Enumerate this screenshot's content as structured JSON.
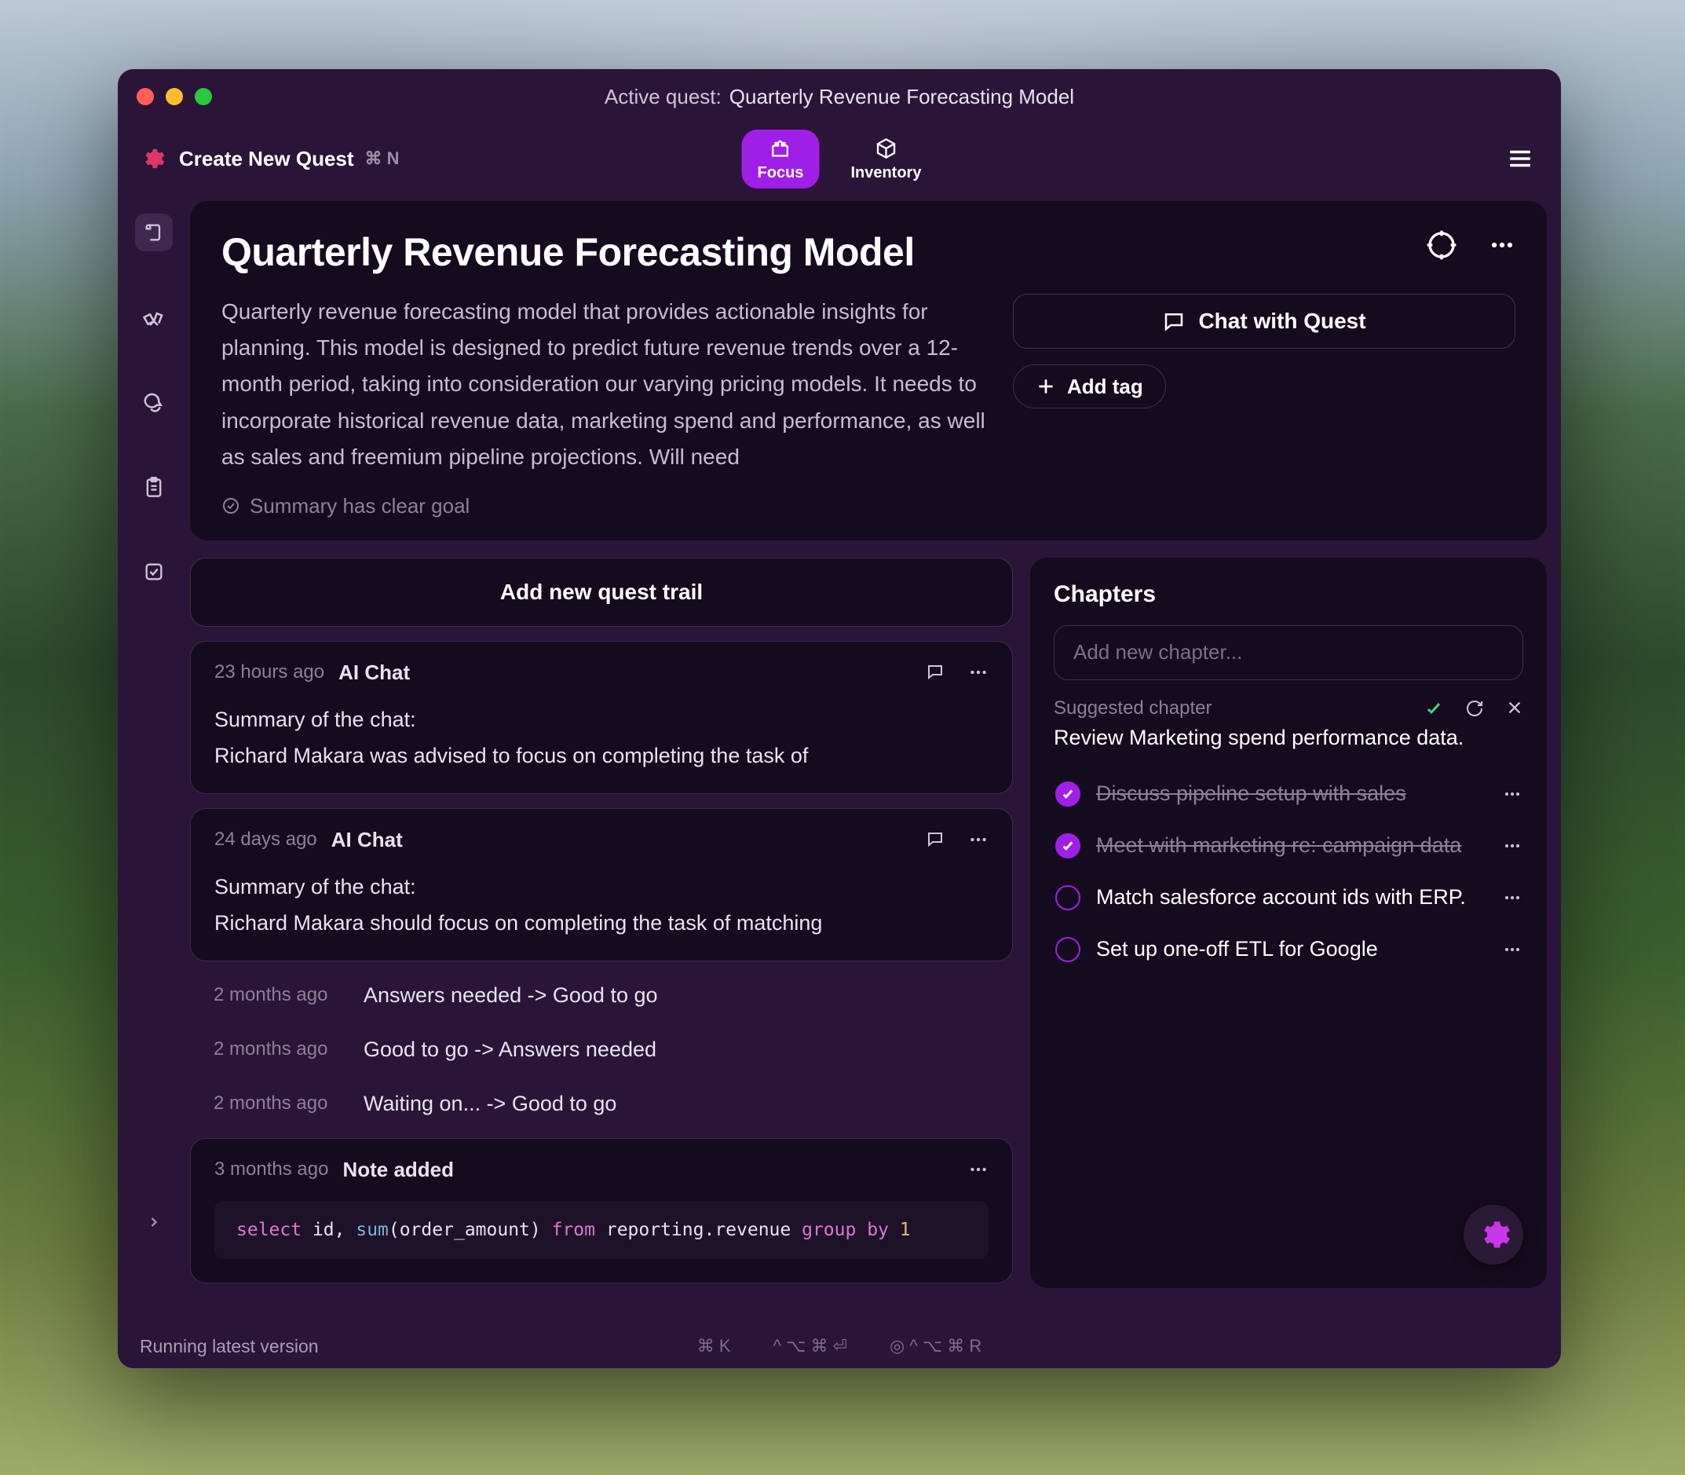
{
  "titlebar": {
    "label": "Active quest:",
    "value": "Quarterly Revenue Forecasting Model"
  },
  "toolbar": {
    "create_label": "Create New Quest",
    "create_shortcut": "⌘ N",
    "tabs": {
      "focus": "Focus",
      "inventory": "Inventory"
    }
  },
  "quest": {
    "title": "Quarterly Revenue Forecasting Model",
    "description": "Quarterly revenue forecasting model that provides actionable insights for planning. This model is designed to predict future revenue trends over a 12-month period, taking into consideration our varying pricing models. It needs to incorporate historical revenue data, marketing spend and performance, as well as sales and freemium pipeline projections. Will need",
    "chat_label": "Chat with Quest",
    "add_tag_label": "Add tag",
    "summary_status": "Summary has clear goal"
  },
  "trail": {
    "add_label": "Add new quest trail",
    "items": [
      {
        "time": "23 hours ago",
        "type": "AI Chat",
        "body_line1": "Summary of the chat:",
        "body_line2": "Richard Makara was advised to focus on completing the task of"
      },
      {
        "time": "24 days ago",
        "type": "AI Chat",
        "body_line1": "Summary of the chat:",
        "body_line2": "Richard Makara should focus on completing the task of matching"
      }
    ],
    "status_changes": [
      {
        "time": "2 months ago",
        "text": "Answers needed -> Good to go"
      },
      {
        "time": "2 months ago",
        "text": "Good to go -> Answers needed"
      },
      {
        "time": "2 months ago",
        "text": "Waiting on... -> Good to go"
      }
    ],
    "note": {
      "time": "3 months ago",
      "type": "Note added",
      "code": {
        "select": "select",
        "cols": " id, ",
        "func": "sum",
        "args": "(order_amount) ",
        "from": "from",
        "table": " reporting.revenue ",
        "group": "group by",
        "num": " 1"
      }
    }
  },
  "chapters": {
    "title": "Chapters",
    "placeholder": "Add new chapter...",
    "suggested_label": "Suggested chapter",
    "suggested_text": "Review Marketing spend performance data.",
    "items": [
      {
        "text": "Discuss pipeline setup with sales",
        "done": true
      },
      {
        "text": "Meet with marketing re: campaign data",
        "done": true
      },
      {
        "text": "Match salesforce account ids with ERP.",
        "done": false
      },
      {
        "text": "Set up one-off ETL for Google",
        "done": false
      }
    ]
  },
  "statusbar": {
    "version": "Running latest version",
    "hint1": "⌘ K",
    "hint2": "^ ⌥ ⌘ ⏎",
    "hint3": "◎  ^ ⌥ ⌘ R"
  }
}
